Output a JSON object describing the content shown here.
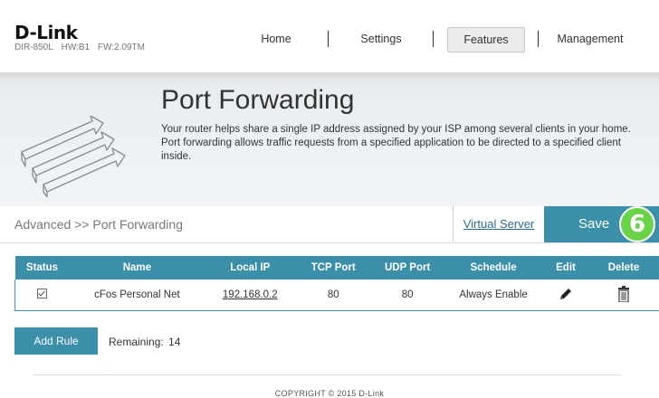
{
  "brand": {
    "logo": "D-Link",
    "model": "DIR-850L",
    "hw": "HW:B1",
    "fw": "FW:2.09TM"
  },
  "nav": {
    "home": "Home",
    "settings": "Settings",
    "features": "Features",
    "management": "Management"
  },
  "banner": {
    "title": "Port Forwarding",
    "line1": "Your router helps share a single IP address assigned by your ISP among several clients in your home.",
    "line2": "Port forwarding allows traffic requests from a specified application to be directed to a specified client",
    "line3": "inside."
  },
  "breadcrumb": "Advanced >> Port Forwarding",
  "virtual_server_link": "Virtual Server",
  "save_label": "Save",
  "step_badge": "6",
  "table": {
    "headers": {
      "status": "Status",
      "name": "Name",
      "local_ip": "Local IP",
      "tcp": "TCP Port",
      "udp": "UDP Port",
      "schedule": "Schedule",
      "edit": "Edit",
      "delete": "Delete"
    },
    "rows": [
      {
        "status": "checked",
        "name": "cFos Personal Net",
        "local_ip": "192.168.0.2",
        "tcp": "80",
        "udp": "80",
        "schedule": "Always Enable"
      }
    ]
  },
  "add_rule_label": "Add Rule",
  "remaining_label": "Remaining:",
  "remaining_value": "14",
  "footer": "COPYRIGHT © 2015 D-Link",
  "colors": {
    "accent": "#3b8fa8",
    "badge": "#6bd34a"
  },
  "icons": {
    "edit": "pencil-icon",
    "delete": "trash-icon",
    "banner": "port-forward-arrows-icon"
  }
}
